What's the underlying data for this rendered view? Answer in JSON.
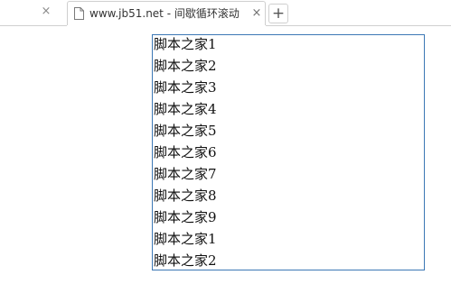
{
  "browser": {
    "prev_tab_close_icon": "close-icon",
    "tab_title": "www.jb51.net - 间歇循环滚动",
    "tab_icon": "page-icon",
    "tab_close_glyph": "×",
    "new_tab_glyph": "+"
  },
  "scroller": {
    "border_color": "#3c78b5",
    "items": [
      "脚本之家1",
      "脚本之家2",
      "脚本之家3",
      "脚本之家4",
      "脚本之家5",
      "脚本之家6",
      "脚本之家7",
      "脚本之家8",
      "脚本之家9",
      "脚本之家1",
      "脚本之家2"
    ]
  }
}
